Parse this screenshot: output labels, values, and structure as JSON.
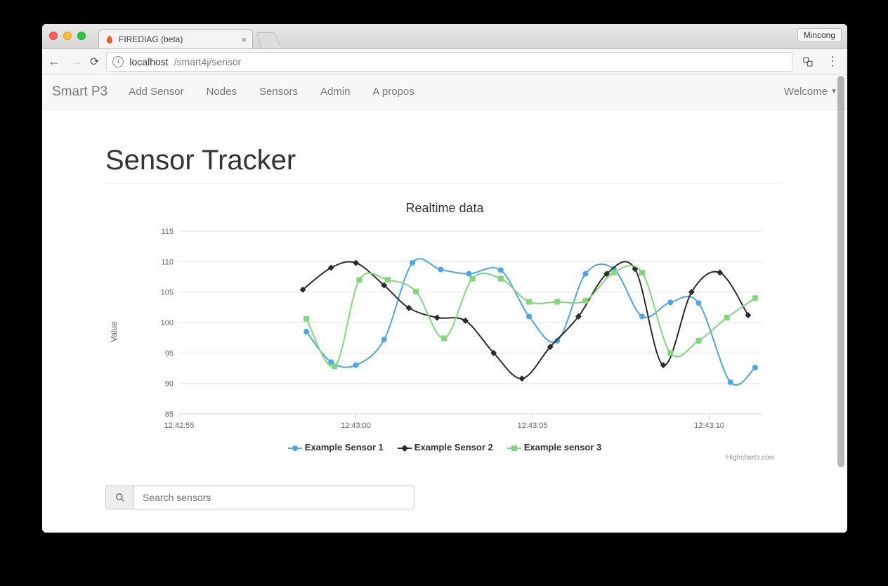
{
  "browser": {
    "tab_title": "FIREDIAG (beta)",
    "profile_name": "Mincong",
    "url_host": "localhost",
    "url_path": "/smart4j/sensor"
  },
  "navbar": {
    "brand": "Smart P3",
    "links": [
      "Add Sensor",
      "Nodes",
      "Sensors",
      "Admin",
      "A propos"
    ],
    "welcome": "Welcome"
  },
  "page": {
    "title": "Sensor Tracker",
    "search_placeholder": "Search sensors"
  },
  "chart_credits": "Highcharts.com",
  "chart_data": {
    "type": "line",
    "title": "Realtime data",
    "xlabel": "",
    "ylabel": "Value",
    "ylim": [
      85,
      115
    ],
    "y_ticks": [
      85,
      90,
      95,
      100,
      105,
      110,
      115
    ],
    "x_ticks": [
      "12:42:55",
      "12:43:00",
      "12:43:05",
      "12:43:10"
    ],
    "x_tick_positions": [
      55,
      60,
      65,
      70
    ],
    "x_range": [
      55,
      71.5
    ],
    "series": [
      {
        "name": "Example Sensor 1",
        "color": "#4aa6e8",
        "marker": "circle",
        "x": [
          58.6,
          59.3,
          60.0,
          60.8,
          61.6,
          62.4,
          63.2,
          64.1,
          64.9,
          65.7,
          66.5,
          67.3,
          68.1,
          68.9,
          69.7,
          70.6,
          71.3
        ],
        "values": [
          98.5,
          93.5,
          93.0,
          97.2,
          109.8,
          108.7,
          108.0,
          108.6,
          101.0,
          97.0,
          108.0,
          108.8,
          101.0,
          103.3,
          103.2,
          90.2,
          92.6
        ]
      },
      {
        "name": "Example Sensor 2",
        "color": "#2b2b2b",
        "marker": "diamond",
        "x": [
          58.5,
          59.3,
          60.0,
          60.8,
          61.5,
          62.3,
          63.1,
          63.9,
          64.7,
          65.5,
          66.3,
          67.1,
          67.9,
          68.7,
          69.5,
          70.3,
          71.1
        ],
        "values": [
          105.4,
          109.0,
          109.8,
          106.1,
          102.4,
          100.8,
          100.3,
          95.0,
          90.8,
          96.0,
          101.0,
          108.0,
          108.8,
          93.0,
          105.0,
          108.2,
          101.2
        ]
      },
      {
        "name": "Example sensor 3",
        "color": "#7fd97a",
        "marker": "square",
        "x": [
          58.6,
          59.4,
          60.1,
          60.9,
          61.7,
          62.5,
          63.3,
          64.1,
          64.9,
          65.7,
          66.5,
          67.3,
          68.1,
          68.9,
          69.7,
          70.5,
          71.3
        ],
        "values": [
          100.6,
          92.8,
          107.0,
          107.0,
          105.1,
          97.4,
          107.2,
          107.2,
          103.4,
          103.4,
          103.6,
          108.2,
          108.2,
          95.0,
          97.0,
          100.8,
          104.0
        ]
      }
    ],
    "legend_position": "bottom"
  }
}
